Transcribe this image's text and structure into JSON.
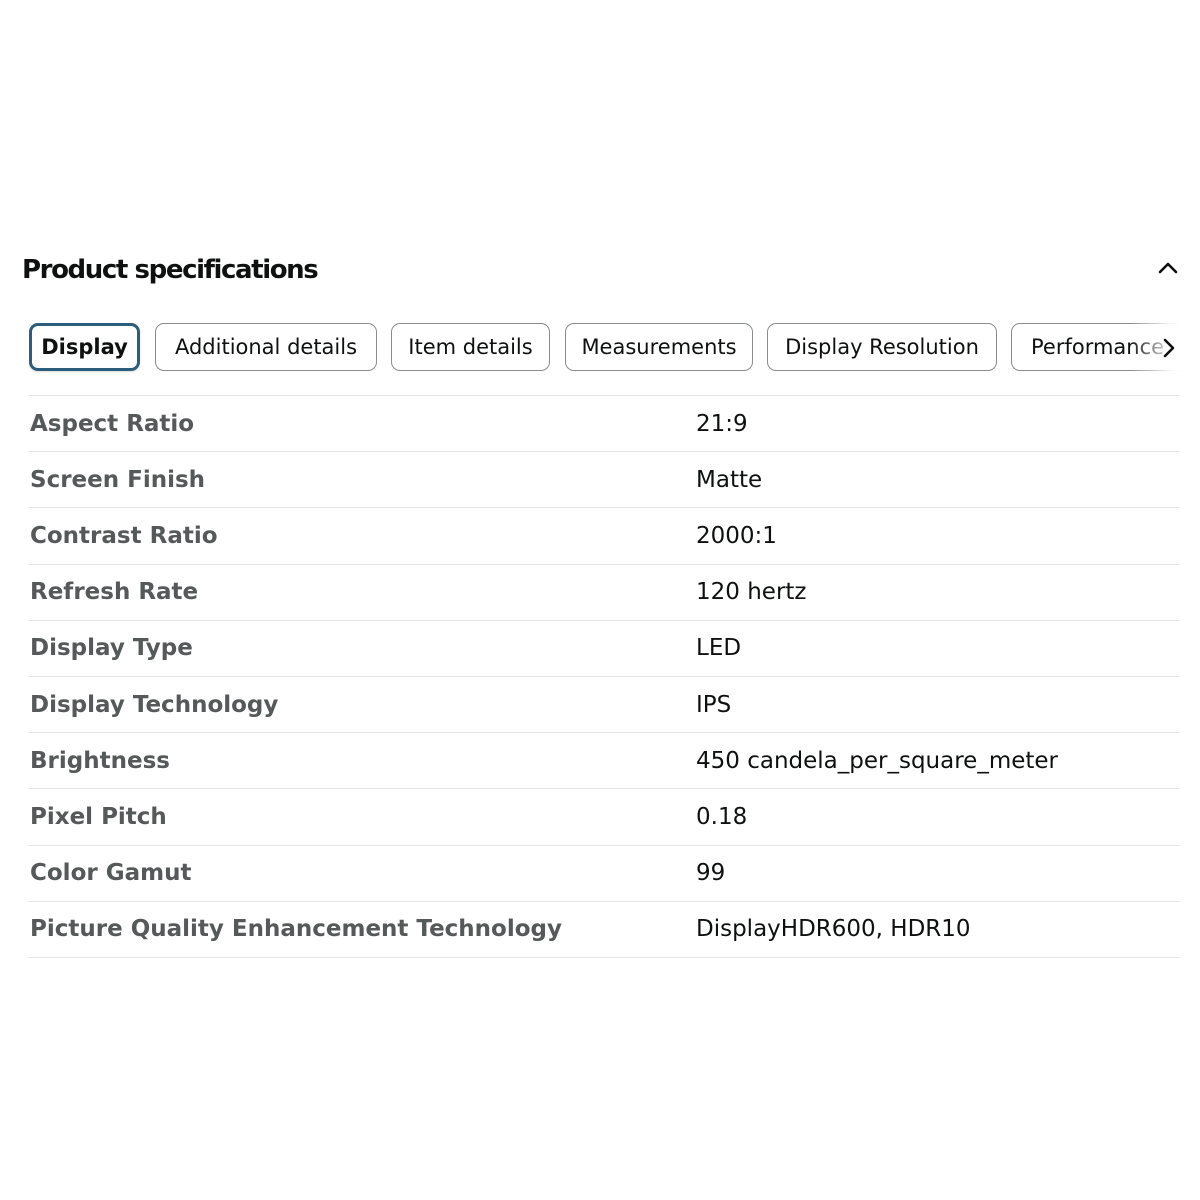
{
  "header": {
    "title": "Product specifications",
    "collapse_icon": "chevron-up-icon"
  },
  "tabs": [
    {
      "label": "Display",
      "active": true
    },
    {
      "label": "Additional details",
      "active": false
    },
    {
      "label": "Item details",
      "active": false
    },
    {
      "label": "Measurements",
      "active": false
    },
    {
      "label": "Display Resolution",
      "active": false
    },
    {
      "label": "Performance",
      "active": false
    }
  ],
  "tabs_scroll_icon": "chevron-right-icon",
  "specs": [
    {
      "key": "Aspect Ratio",
      "value": "21:9"
    },
    {
      "key": "Screen Finish",
      "value": "Matte"
    },
    {
      "key": "Contrast Ratio",
      "value": "2000:1"
    },
    {
      "key": "Refresh Rate",
      "value": "120 hertz"
    },
    {
      "key": "Display Type",
      "value": "LED"
    },
    {
      "key": "Display Technology",
      "value": "IPS"
    },
    {
      "key": "Brightness",
      "value": "450 candela_per_square_meter"
    },
    {
      "key": "Pixel Pitch",
      "value": "0.18"
    },
    {
      "key": "Color Gamut",
      "value": "99"
    },
    {
      "key": "Picture Quality Enhancement Technology",
      "value": "DisplayHDR600, HDR10"
    }
  ],
  "colors": {
    "active_tab_border": "#2c5d7d",
    "tab_border": "#888c8c",
    "key_text": "#565959",
    "value_text": "#0f1111",
    "divider": "#e3e6e6"
  }
}
